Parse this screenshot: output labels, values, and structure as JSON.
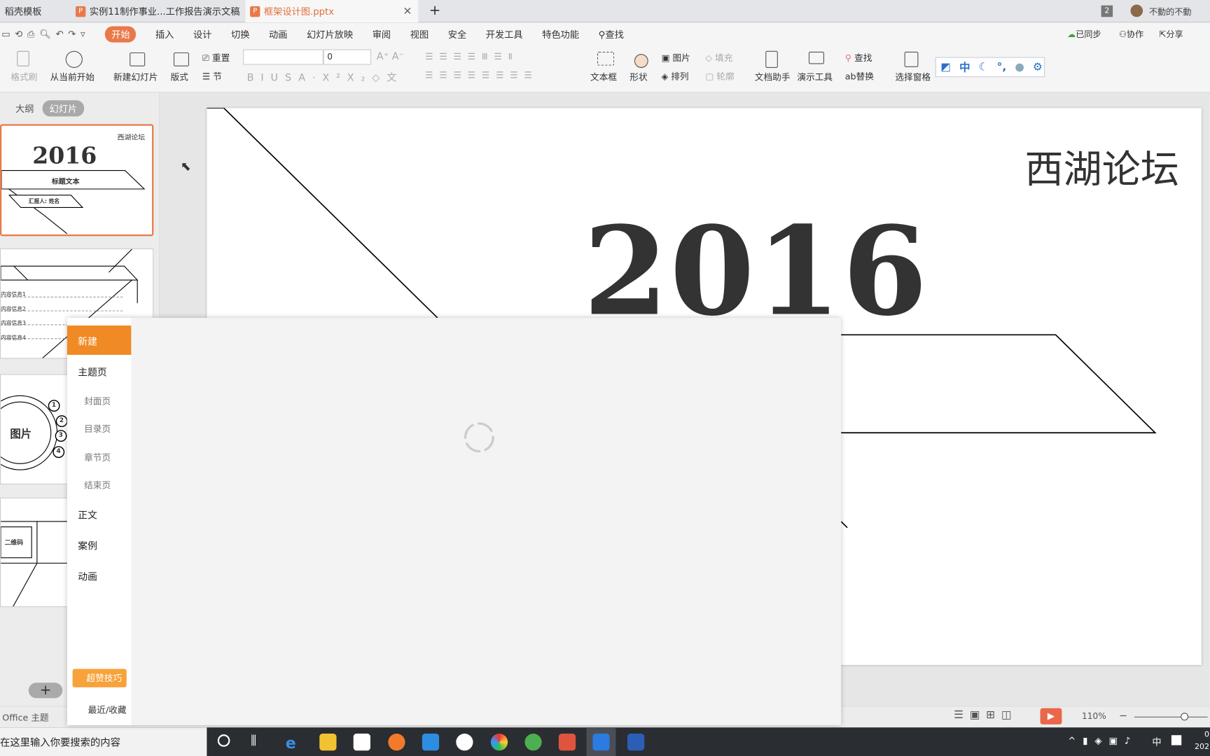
{
  "tabs": [
    {
      "label": "稻壳模板"
    },
    {
      "label": "实例11制作事业...工作报告演示文稿"
    },
    {
      "label": "框架设计图.pptx",
      "active": true
    }
  ],
  "tab_count_badge": "2",
  "user_name": "不動的不動",
  "menu": [
    "开始",
    "插入",
    "设计",
    "切换",
    "动画",
    "幻灯片放映",
    "审阅",
    "视图",
    "安全",
    "开发工具",
    "特色功能"
  ],
  "menu_search": "查找",
  "menu_right": {
    "sync": "已同步",
    "collab": "协作",
    "share": "分享"
  },
  "ribbon": {
    "format_painter": "格式刷",
    "play_from_current": "从当前开始",
    "new_slide": "新建幻灯片",
    "layout": "版式",
    "reset": "重置",
    "section": "节",
    "font_size": "0",
    "textbox": "文本框",
    "shape": "形状",
    "picture": "图片",
    "fill": "填充",
    "arrange": "排列",
    "outline": "轮廓",
    "doc_helper": "文档助手",
    "present_tools": "演示工具",
    "find": "查找",
    "replace": "替换",
    "select_pane": "选择窗格",
    "ime_lang": "中"
  },
  "panel_tabs": {
    "outline": "大纲",
    "slides": "幻灯片"
  },
  "thumbs": {
    "s1_title": "西湖论坛",
    "s1_year": "2016",
    "s1_heading": "标题文本",
    "s1_reporter": "汇报人: 姓名",
    "s2_items": [
      "内容信息1",
      "内容信息2",
      "内容信息3",
      "内容信息4"
    ],
    "s3_picture": "图片",
    "s3_nums": [
      "1",
      "2",
      "3",
      "4"
    ],
    "s4_qr": "二维码"
  },
  "slide": {
    "title": "西湖论坛",
    "year": "2016"
  },
  "modal": {
    "items": [
      {
        "label": "新建",
        "active": true
      },
      {
        "label": "主题页"
      },
      {
        "label": "封面页",
        "sub": true
      },
      {
        "label": "目录页",
        "sub": true
      },
      {
        "label": "章节页",
        "sub": true
      },
      {
        "label": "结束页",
        "sub": true
      },
      {
        "label": "正文"
      },
      {
        "label": "案例"
      },
      {
        "label": "动画"
      }
    ],
    "tips": "超赞技巧",
    "recent": "最近/收藏",
    "accent": "#f08a24"
  },
  "status": {
    "theme": "Office 主题",
    "zoom": "110%"
  },
  "taskbar": {
    "search_placeholder": "在这里输入你要搜索的内容",
    "ime": "中",
    "clock_top": "0",
    "clock_bottom": "202"
  }
}
